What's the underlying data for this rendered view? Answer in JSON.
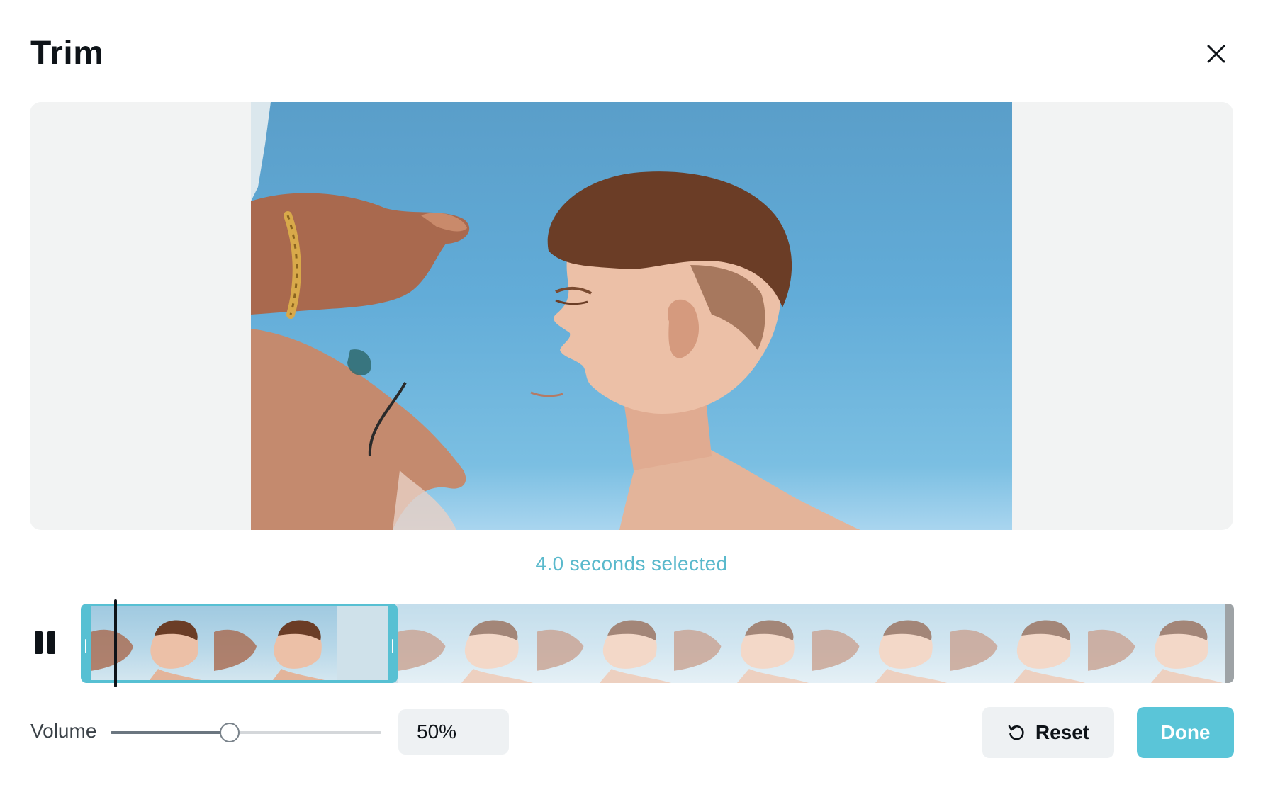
{
  "dialog": {
    "title": "Trim"
  },
  "icons": {
    "close": "close-icon",
    "pause": "pause-icon",
    "reset": "reset-icon"
  },
  "preview": {
    "subject": "video-frame"
  },
  "trim": {
    "selected_text": "4.0 seconds selected",
    "frame_count": 8,
    "selected_frames": 2,
    "playhead_fraction": 0.05
  },
  "volume": {
    "label": "Volume",
    "value_text": "50%",
    "level": 0.5
  },
  "buttons": {
    "reset_label": "Reset",
    "done_label": "Done"
  },
  "colors": {
    "accent": "#57c0d3",
    "done_button": "#5ac5d8",
    "selected_text": "#5ab9cc",
    "sky": "#62acd8"
  }
}
